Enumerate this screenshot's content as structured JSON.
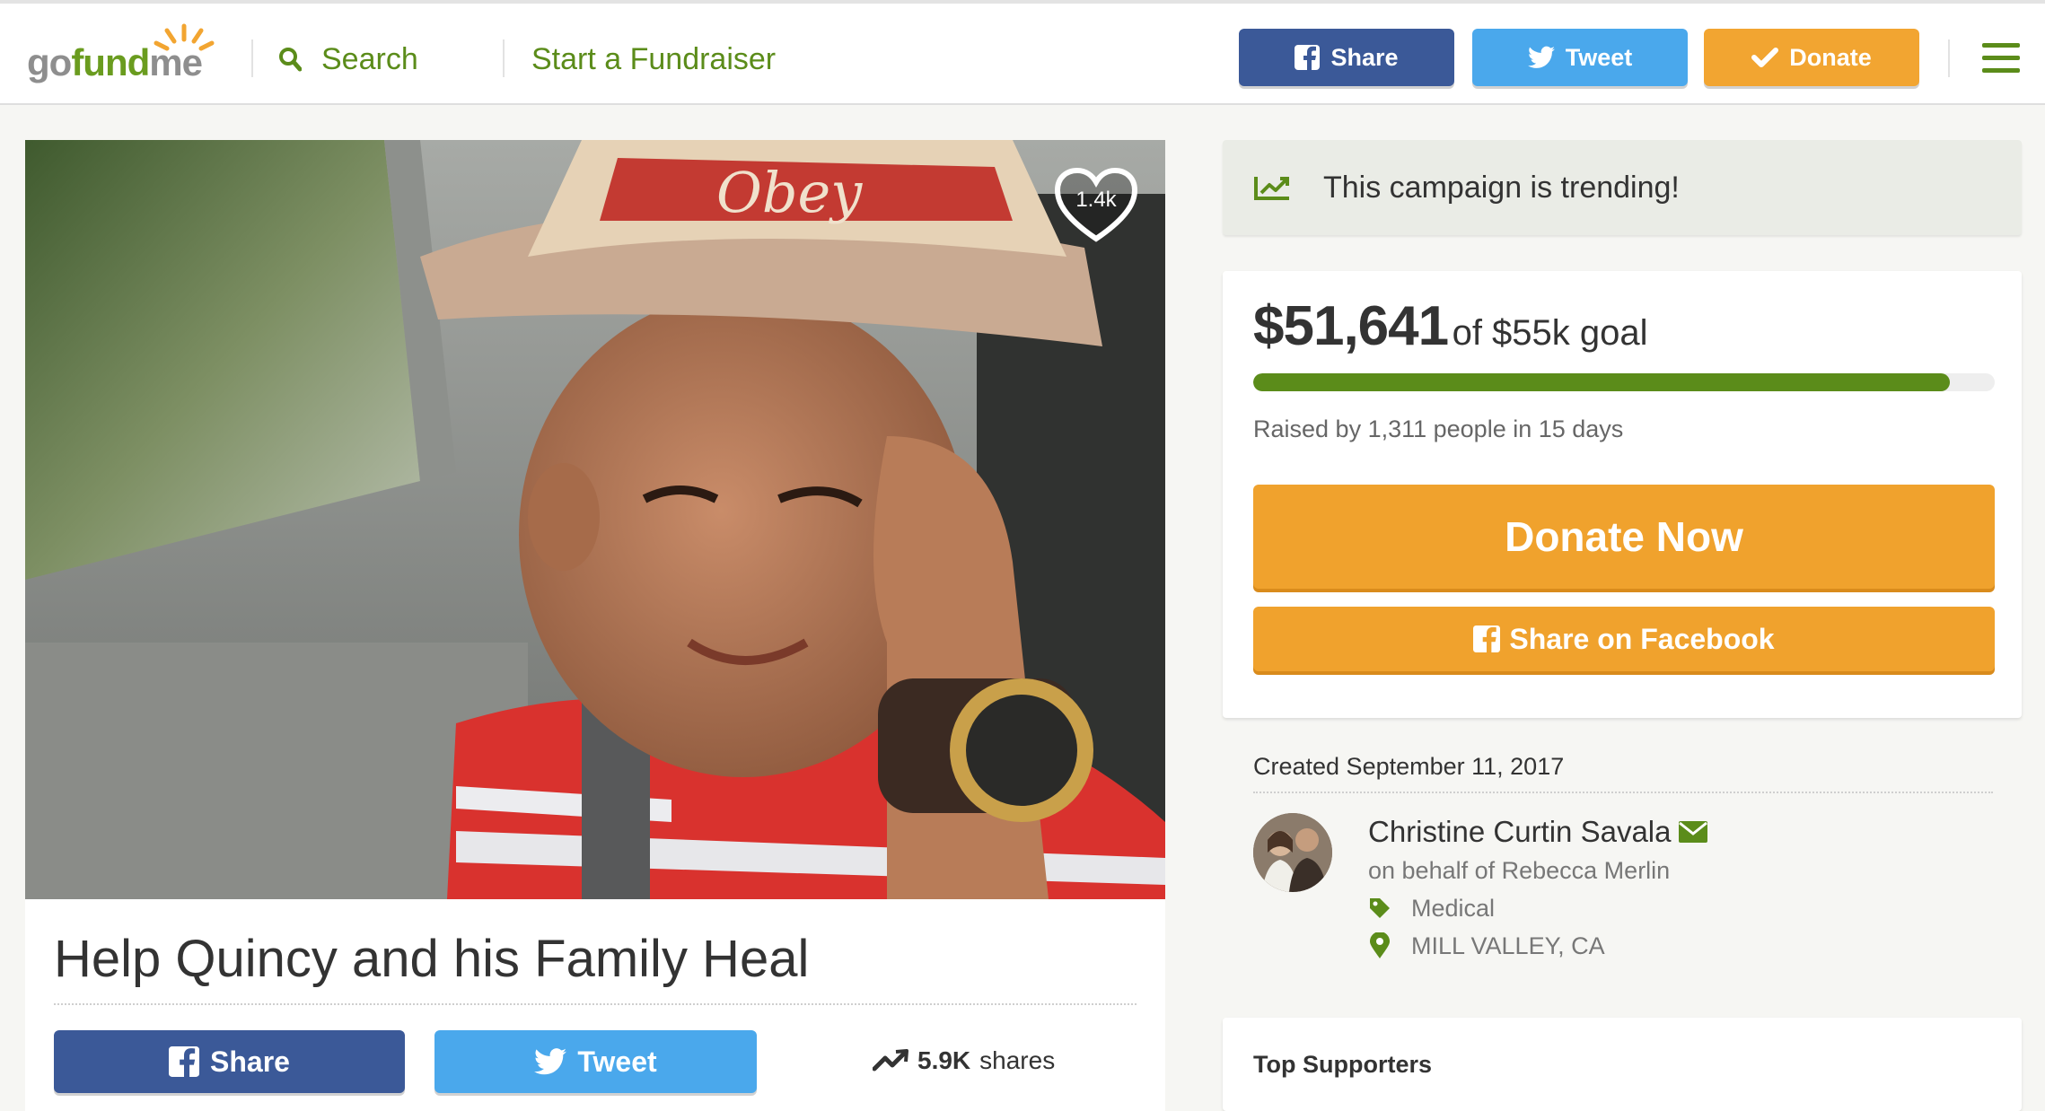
{
  "header": {
    "logo": "gofundme",
    "search_label": "Search",
    "start_label": "Start a Fundraiser",
    "share_label": "Share",
    "tweet_label": "Tweet",
    "donate_label": "Donate"
  },
  "campaign": {
    "likes": "1.4k",
    "title": "Help Quincy and his Family Heal",
    "share_label": "Share",
    "tweet_label": "Tweet",
    "shares_count": "5.9K",
    "shares_suffix": "shares"
  },
  "sidebar": {
    "trending_text": "This campaign is trending!",
    "raised_amount": "$51,641",
    "goal_text": "of $55k goal",
    "progress_fraction": 0.939,
    "raised_by": "Raised by 1,311 people in 15 days",
    "donate_now_label": "Donate Now",
    "share_facebook_label": "Share on Facebook",
    "created": "Created September 11, 2017",
    "organizer_name": "Christine Curtin Savala",
    "on_behalf": "on behalf of Rebecca Merlin",
    "category": "Medical",
    "location": "MILL VALLEY, CA",
    "top_supporters_title": "Top Supporters"
  },
  "colors": {
    "brand_green": "#5b8c1a",
    "facebook_blue": "#3b5998",
    "twitter_blue": "#4aa8ec",
    "donate_orange": "#f0a22d"
  },
  "icons": [
    "search-icon",
    "facebook-icon",
    "twitter-icon",
    "check-icon",
    "menu-icon",
    "heart-icon",
    "trend-icon",
    "envelope-icon",
    "tag-icon",
    "map-pin-icon"
  ]
}
